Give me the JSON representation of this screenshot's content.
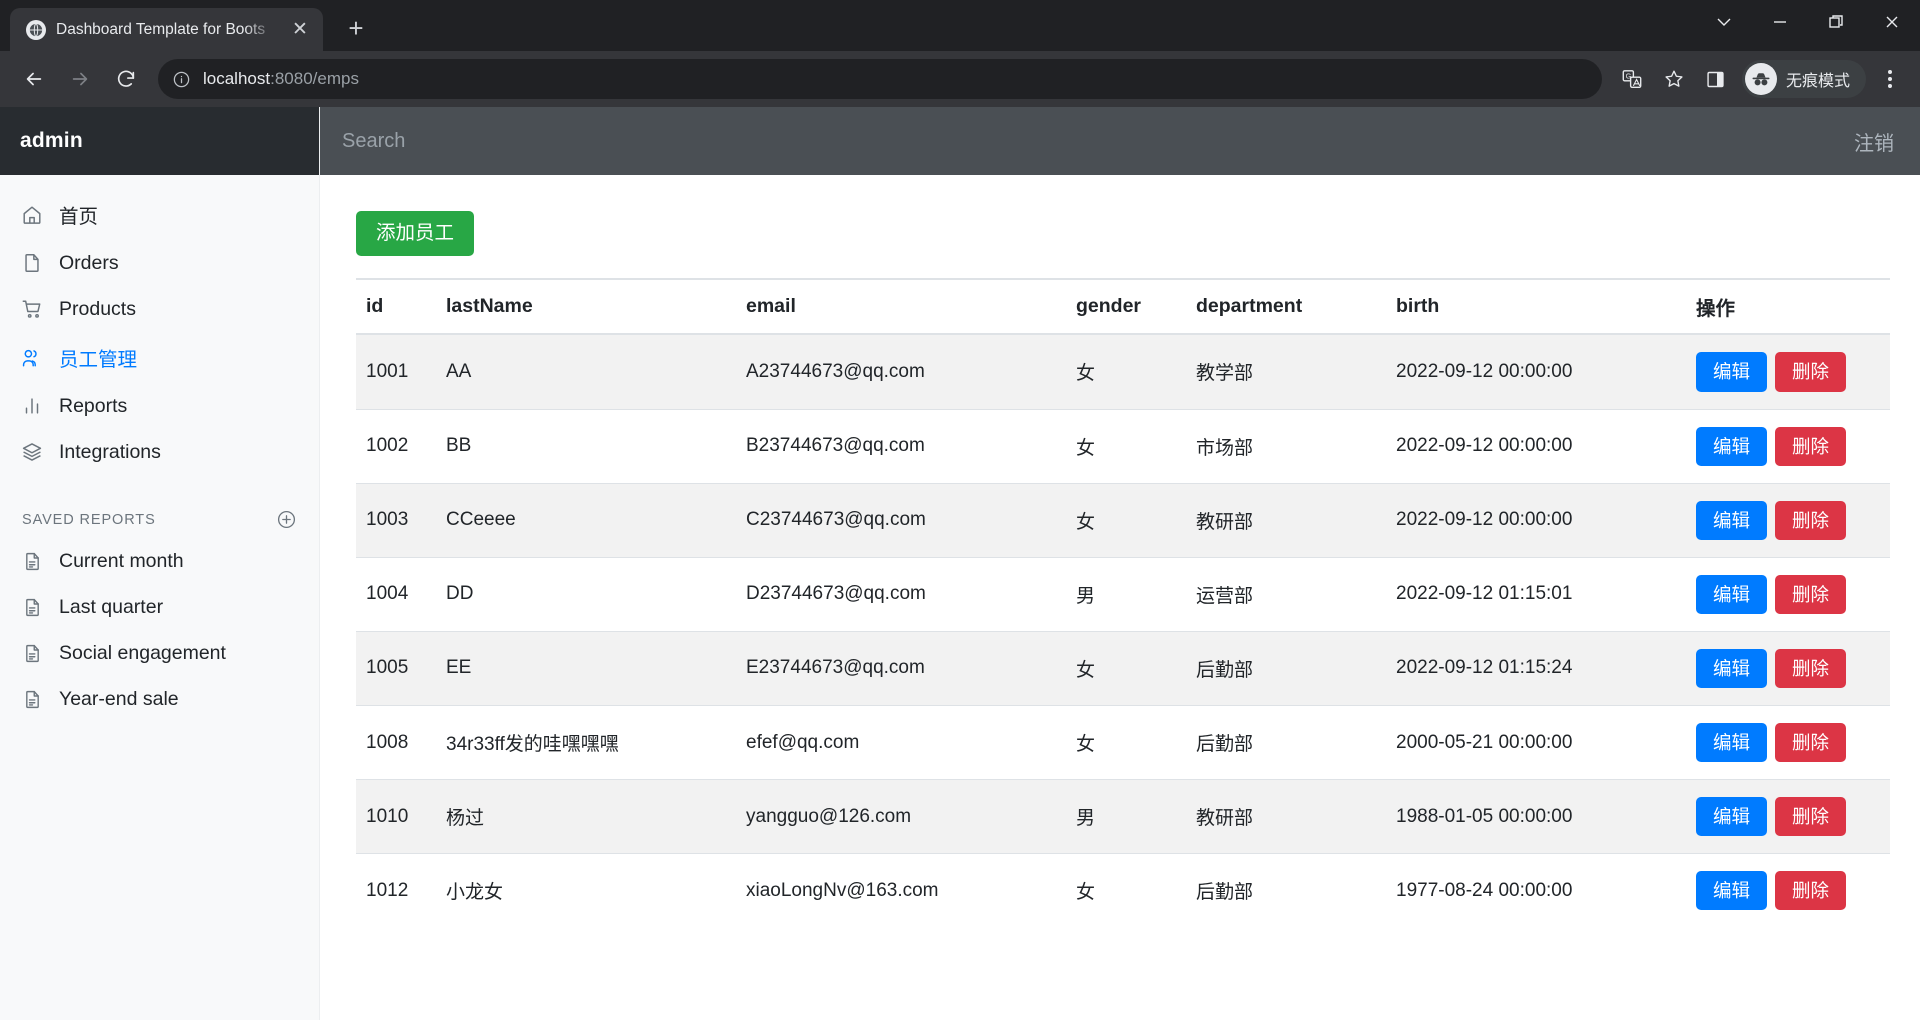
{
  "browser": {
    "tab": {
      "title": "Dashboard Template for Boots",
      "favicon": "globe-icon",
      "close": "✕"
    },
    "new_tab": "+",
    "window_controls": {
      "minimize": "—",
      "maximize": "❐",
      "close": "✕",
      "tab_search": "⌄"
    },
    "toolbar": {
      "back": "←",
      "forward": "→",
      "reload": "↻",
      "url_host": "localhost",
      "url_rest": ":8080/emps",
      "translate": "translate-icon",
      "bookmark": "star-icon",
      "side_panel": "side-panel-icon",
      "incognito_label": "无痕模式",
      "menu": "kebab-menu-icon"
    }
  },
  "sidebar": {
    "brand": "admin",
    "items": [
      {
        "label": "首页",
        "icon": "home-icon",
        "active": false
      },
      {
        "label": "Orders",
        "icon": "file-icon",
        "active": false
      },
      {
        "label": "Products",
        "icon": "cart-icon",
        "active": false
      },
      {
        "label": "员工管理",
        "icon": "users-icon",
        "active": true
      },
      {
        "label": "Reports",
        "icon": "bar-chart-icon",
        "active": false
      },
      {
        "label": "Integrations",
        "icon": "layers-icon",
        "active": false
      }
    ],
    "saved_reports": {
      "title": "SAVED REPORTS",
      "add": "plus-circle-icon",
      "items": [
        {
          "label": "Current month",
          "icon": "file-text-icon"
        },
        {
          "label": "Last quarter",
          "icon": "file-text-icon"
        },
        {
          "label": "Social engagement",
          "icon": "file-text-icon"
        },
        {
          "label": "Year-end sale",
          "icon": "file-text-icon"
        }
      ]
    }
  },
  "topbar": {
    "search_placeholder": "Search",
    "search_value": "",
    "logout_label": "注销"
  },
  "main": {
    "add_button": "添加员工",
    "table": {
      "headers": [
        "id",
        "lastName",
        "email",
        "gender",
        "department",
        "birth",
        "操作"
      ],
      "row_actions": {
        "edit": "编辑",
        "delete": "删除"
      },
      "rows": [
        {
          "id": "1001",
          "lastName": "AA",
          "email": "A23744673@qq.com",
          "gender": "女",
          "department": "教学部",
          "birth": "2022-09-12 00:00:00"
        },
        {
          "id": "1002",
          "lastName": "BB",
          "email": "B23744673@qq.com",
          "gender": "女",
          "department": "市场部",
          "birth": "2022-09-12 00:00:00"
        },
        {
          "id": "1003",
          "lastName": "CCeeee",
          "email": "C23744673@qq.com",
          "gender": "女",
          "department": "教研部",
          "birth": "2022-09-12 00:00:00"
        },
        {
          "id": "1004",
          "lastName": "DD",
          "email": "D23744673@qq.com",
          "gender": "男",
          "department": "运营部",
          "birth": "2022-09-12 01:15:01"
        },
        {
          "id": "1005",
          "lastName": "EE",
          "email": "E23744673@qq.com",
          "gender": "女",
          "department": "后勤部",
          "birth": "2022-09-12 01:15:24"
        },
        {
          "id": "1008",
          "lastName": "34r33ff发的哇嘿嘿嘿",
          "email": "efef@qq.com",
          "gender": "女",
          "department": "后勤部",
          "birth": "2000-05-21 00:00:00"
        },
        {
          "id": "1010",
          "lastName": "杨过",
          "email": "yangguo@126.com",
          "gender": "男",
          "department": "教研部",
          "birth": "1988-01-05 00:00:00"
        },
        {
          "id": "1012",
          "lastName": "小龙女",
          "email": "xiaoLongNv@163.com",
          "gender": "女",
          "department": "后勤部",
          "birth": "1977-08-24 00:00:00"
        }
      ]
    }
  },
  "colors": {
    "accent": "#007bff",
    "success": "#28a745",
    "danger": "#dc3545",
    "sidebar_bg": "#f8f9fa",
    "brand_bg": "#282c30",
    "topbar_bg": "#4a4f54"
  }
}
